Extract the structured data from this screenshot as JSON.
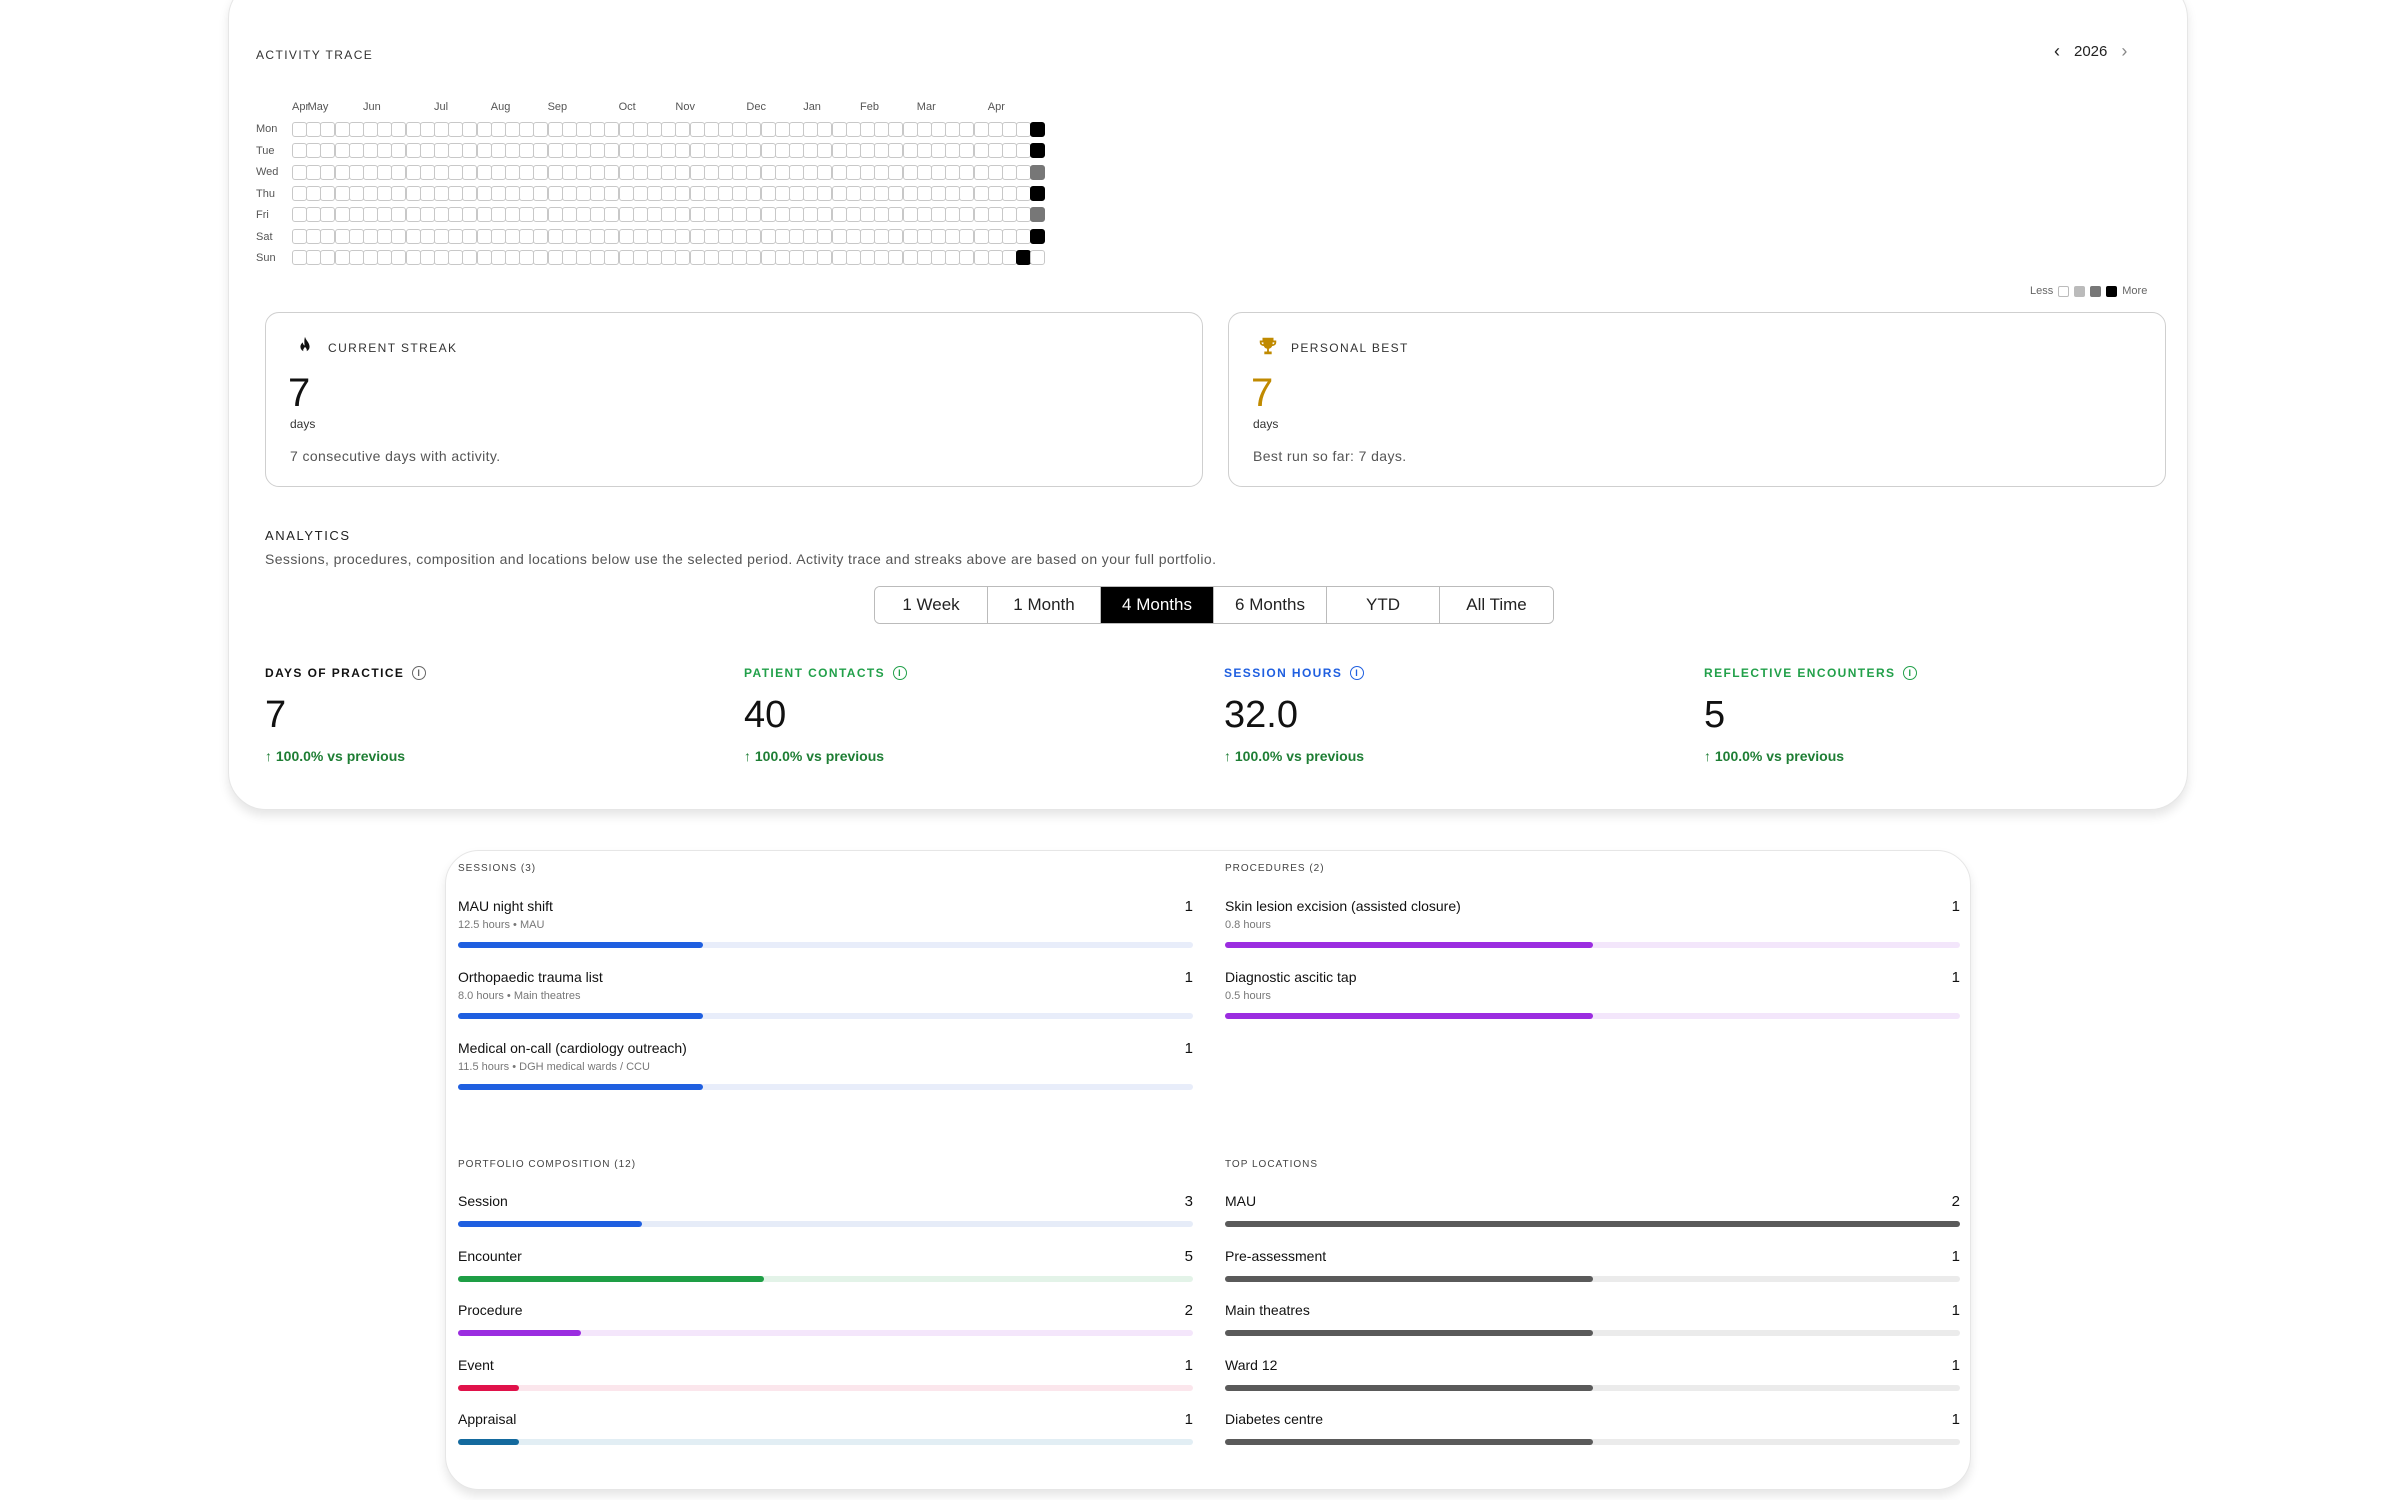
{
  "activity": {
    "title": "ACTIVITY TRACE",
    "year": "2026",
    "months": [
      "Apr",
      "May",
      "Jun",
      "Jul",
      "Aug",
      "Sep",
      "Oct",
      "Nov",
      "Dec",
      "Jan",
      "Feb",
      "Mar",
      "Apr"
    ],
    "days": [
      "Mon",
      "Tue",
      "Wed",
      "Thu",
      "Fri",
      "Sat",
      "Sun"
    ],
    "legend": {
      "less": "Less",
      "more": "More"
    },
    "colors": {
      "empty": "#ffffff",
      "medium": "#777777",
      "high": "#000000"
    },
    "active_cells": [
      {
        "week": 52,
        "day": 0,
        "level": "high"
      },
      {
        "week": 52,
        "day": 1,
        "level": "high"
      },
      {
        "week": 52,
        "day": 2,
        "level": "medium"
      },
      {
        "week": 52,
        "day": 3,
        "level": "high"
      },
      {
        "week": 52,
        "day": 4,
        "level": "medium"
      },
      {
        "week": 52,
        "day": 5,
        "level": "high"
      },
      {
        "week": 51,
        "day": 6,
        "level": "high"
      }
    ]
  },
  "streaks": {
    "current": {
      "label": "CURRENT STREAK",
      "value": "7",
      "unit": "days",
      "description": "7 consecutive days with activity.",
      "icon": "flame-icon"
    },
    "best": {
      "label": "PERSONAL BEST",
      "value": "7",
      "unit": "days",
      "description": "Best run so far: 7 days.",
      "icon": "trophy-icon",
      "accent": "#c08a00"
    }
  },
  "analytics": {
    "title": "ANALYTICS",
    "subtitle": "Sessions, procedures, composition and locations below use the selected period. Activity trace and streaks above are based on your full portfolio.",
    "periods": [
      "1 Week",
      "1 Month",
      "4 Months",
      "6 Months",
      "YTD",
      "All Time"
    ],
    "selected_period": "4 Months"
  },
  "kpis": [
    {
      "label": "DAYS OF PRACTICE",
      "value": "7",
      "change": "100.0% vs previous",
      "color": "#111111"
    },
    {
      "label": "PATIENT CONTACTS",
      "value": "40",
      "change": "100.0% vs previous",
      "color": "#22a04a"
    },
    {
      "label": "SESSION HOURS",
      "value": "32.0",
      "change": "100.0% vs previous",
      "color": "#1f5fe0"
    },
    {
      "label": "REFLECTIVE ENCOUNTERS",
      "value": "5",
      "change": "100.0% vs previous",
      "color": "#22a04a"
    }
  ],
  "sessions": {
    "title": "SESSIONS (3)",
    "items": [
      {
        "name": "MAU night shift",
        "meta": "12.5 hours • MAU",
        "count": "1",
        "fraction": 0.333
      },
      {
        "name": "Orthopaedic trauma list",
        "meta": "8.0 hours • Main theatres",
        "count": "1",
        "fraction": 0.333
      },
      {
        "name": "Medical on-call (cardiology outreach)",
        "meta": "11.5 hours • DGH medical wards / CCU",
        "count": "1",
        "fraction": 0.333
      }
    ],
    "color": "#1f5fe0",
    "track": "#e8edfa"
  },
  "procedures": {
    "title": "PROCEDURES (2)",
    "items": [
      {
        "name": "Skin lesion excision (assisted closure)",
        "meta": "0.8 hours",
        "count": "1",
        "fraction": 0.5
      },
      {
        "name": "Diagnostic ascitic tap",
        "meta": "0.5 hours",
        "count": "1",
        "fraction": 0.5
      }
    ],
    "color": "#9b2de0",
    "track": "#f3e6fb"
  },
  "composition": {
    "title": "PORTFOLIO COMPOSITION (12)",
    "items": [
      {
        "name": "Session",
        "count": "3",
        "fraction": 0.25,
        "color": "#1f5fe0",
        "track": "#e6ecf8"
      },
      {
        "name": "Encounter",
        "count": "5",
        "fraction": 0.417,
        "color": "#1e9e45",
        "track": "#e3f3e8"
      },
      {
        "name": "Procedure",
        "count": "2",
        "fraction": 0.167,
        "color": "#9b2de0",
        "track": "#f4e6fb"
      },
      {
        "name": "Event",
        "count": "1",
        "fraction": 0.083,
        "color": "#e0124a",
        "track": "#fbe6ec"
      },
      {
        "name": "Appraisal",
        "count": "1",
        "fraction": 0.083,
        "color": "#146a9e",
        "track": "#e2eef4"
      }
    ]
  },
  "locations": {
    "title": "TOP LOCATIONS",
    "items": [
      {
        "name": "MAU",
        "count": "2",
        "fraction": 1.0
      },
      {
        "name": "Pre-assessment",
        "count": "1",
        "fraction": 0.5
      },
      {
        "name": "Main theatres",
        "count": "1",
        "fraction": 0.5
      },
      {
        "name": "Ward 12",
        "count": "1",
        "fraction": 0.5
      },
      {
        "name": "Diabetes centre",
        "count": "1",
        "fraction": 0.5
      }
    ],
    "color": "#5a5a5a",
    "track": "#ebebeb"
  }
}
